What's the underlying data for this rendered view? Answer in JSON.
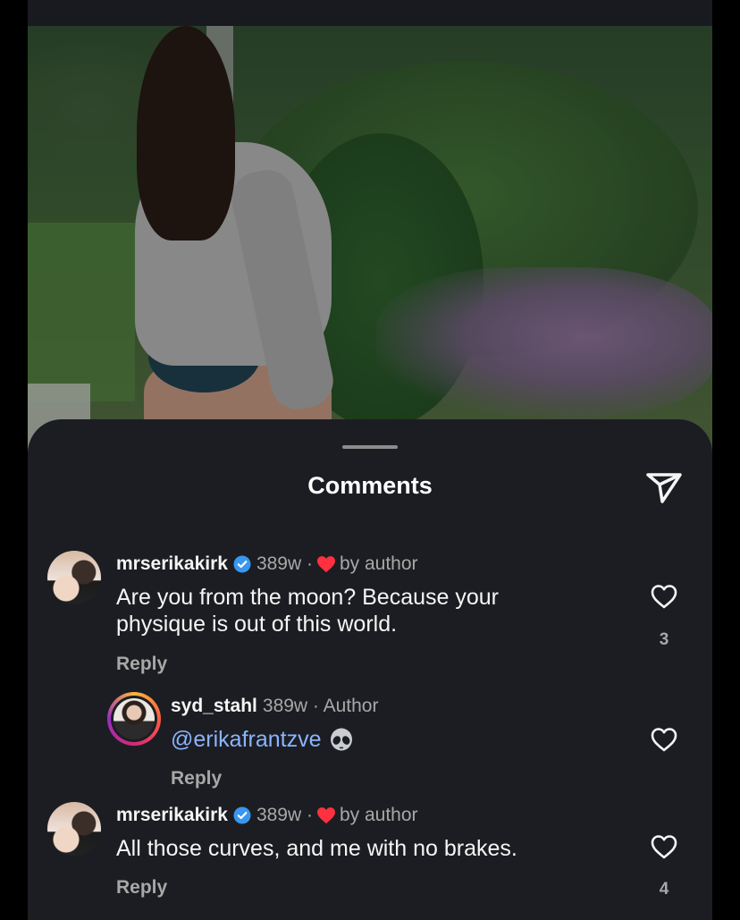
{
  "sheet": {
    "title": "Comments"
  },
  "comments": [
    {
      "username": "mrserikakirk",
      "age": "389w ·",
      "by_author": "by author",
      "text_line1": "Are you from the moon? Because your",
      "text_line2": "physique is out of this world.",
      "reply_label": "Reply",
      "likes": "3"
    },
    {
      "username": "syd_stahl",
      "age": "389w · Author",
      "mention": "@erikafrantzve",
      "emoji": "alien-icon",
      "reply_label": "Reply"
    },
    {
      "username": "mrserikakirk",
      "age": "389w ·",
      "by_author": "by author",
      "text_line1": "All those curves, and me with no brakes.",
      "reply_label": "Reply",
      "likes": "4"
    }
  ],
  "colors": {
    "sheet_bg": "#1c1d22",
    "verified": "#3897f0",
    "heart": "#ff3040",
    "mention": "#8ab4ff",
    "muted": "#a8a8a8"
  }
}
